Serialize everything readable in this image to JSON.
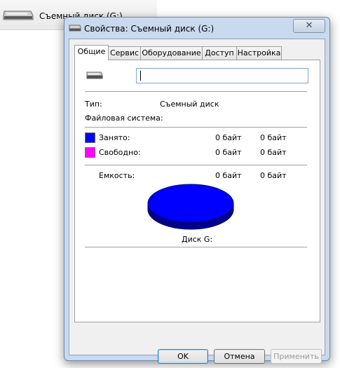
{
  "background_item": {
    "label": "Съемный диск (G:)",
    "icon": "removable-drive-icon"
  },
  "window": {
    "title": "Свойства: Съемный диск (G:)",
    "close_glyph": "✕",
    "icon": "removable-drive-icon"
  },
  "tabs": [
    {
      "label": "Общие",
      "active": true
    },
    {
      "label": "Сервис",
      "active": false
    },
    {
      "label": "Оборудование",
      "active": false
    },
    {
      "label": "Доступ",
      "active": false
    },
    {
      "label": "Настройка",
      "active": false
    }
  ],
  "general": {
    "drive_name_value": "",
    "type_label": "Тип:",
    "type_value": "Съемный диск",
    "fs_label": "Файловая система:",
    "fs_value": "",
    "used": {
      "label": "Занято:",
      "bytes": "0 байт",
      "size": "0 байт",
      "color": "#0000ff"
    },
    "free": {
      "label": "Свободно:",
      "bytes": "0 байт",
      "size": "0 байт",
      "color": "#ff00ff"
    },
    "capacity": {
      "label": "Емкость:",
      "bytes": "0 байт",
      "size": "0 байт"
    },
    "disk_label": "Диск G:",
    "pie": {
      "used_fraction": 1.0,
      "free_fraction": 0.0,
      "used_color": "#0000ff",
      "free_color": "#ff00ff"
    }
  },
  "buttons": {
    "ok": "OK",
    "cancel": "Отмена",
    "apply": "Применить"
  }
}
